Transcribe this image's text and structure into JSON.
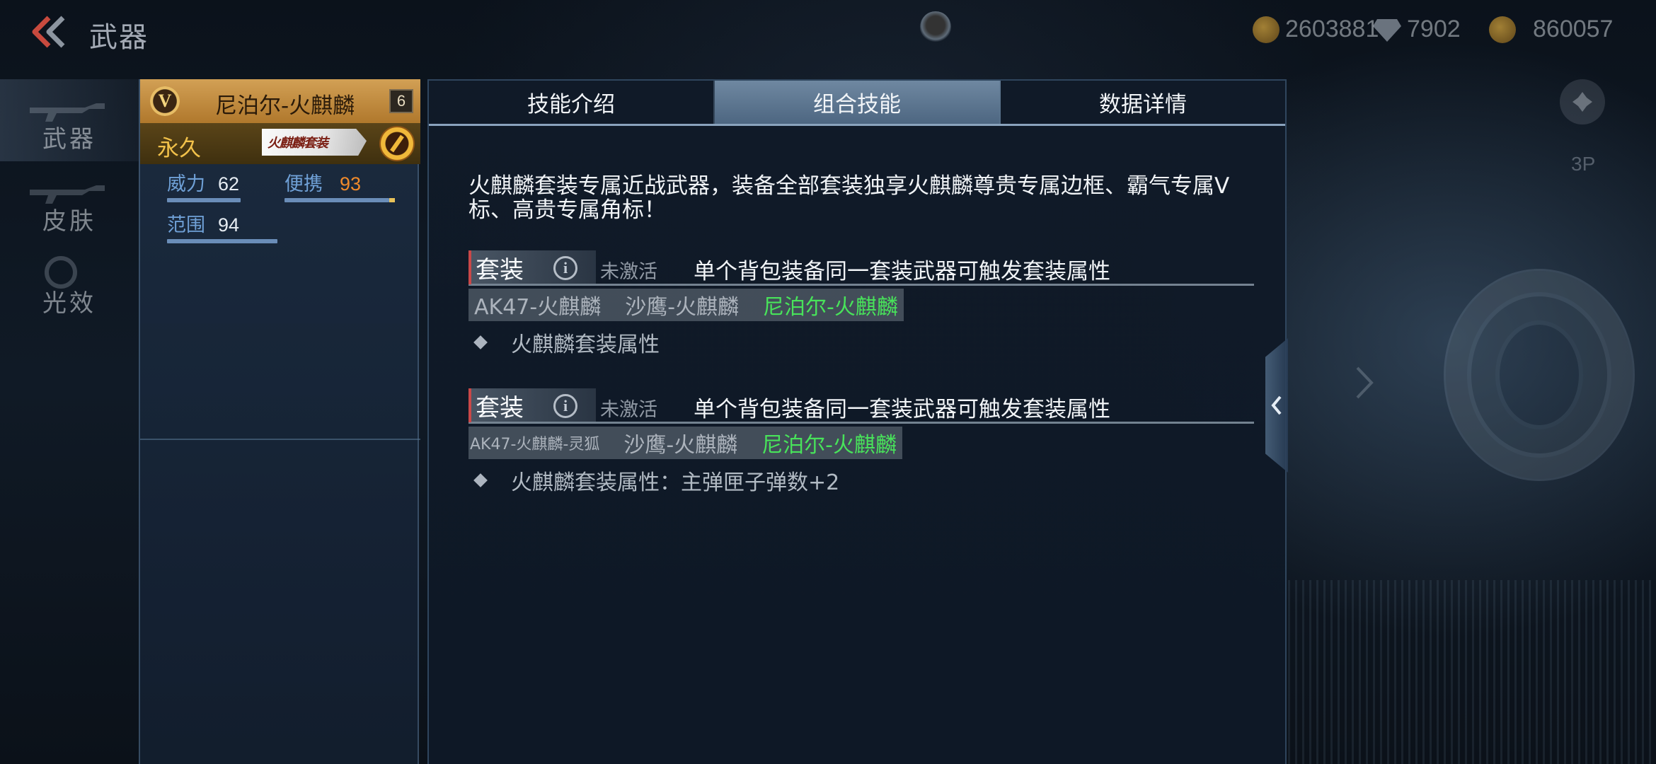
{
  "header": {
    "title": "武器",
    "currencies": [
      {
        "icon": "coin-icon",
        "value": "2603881"
      },
      {
        "icon": "diamond-icon",
        "value": "7902"
      },
      {
        "icon": "coin-icon",
        "value": "860057"
      }
    ]
  },
  "sidenav": {
    "items": [
      {
        "label": "武器",
        "active": true
      },
      {
        "label": "皮肤",
        "active": false
      },
      {
        "label": "光效",
        "active": false
      }
    ]
  },
  "weapon": {
    "badge": "V",
    "name": "尼泊尔-火麒麟",
    "level": "6",
    "duration": "永久",
    "set_tag": "火麒麟套装",
    "stats": [
      {
        "label": "威力",
        "value": "62",
        "fill": 0.62
      },
      {
        "label": "便携",
        "value": "93",
        "fill": 0.93
      },
      {
        "label": "范围",
        "value": "94",
        "fill": 0.94
      }
    ]
  },
  "tabs": [
    "技能介绍",
    "组合技能",
    "数据详情"
  ],
  "active_tab": 1,
  "description": "火麒麟套装专属近战武器，装备全部套装独享火麒麟尊贵专属边框、霸气专属V标、高贵专属角标！",
  "suits": [
    {
      "label": "套装",
      "info_icon": "i",
      "status": "未激活",
      "rule": "单个背包装备同一套装武器可触发套装属性",
      "pieces": [
        "AK47-火麒麟",
        "沙鹰-火麒麟",
        "尼泊尔-火麒麟"
      ],
      "attribute": "火麒麟套装属性"
    },
    {
      "label": "套装",
      "info_icon": "i",
      "status": "未激活",
      "rule": "单个背包装备同一套装武器可触发套装属性",
      "pieces": [
        "AK47-火麒麟-灵狐",
        "沙鹰-火麒麟",
        "尼泊尔-火麒麟"
      ],
      "attribute": "火麒麟套装属性：主弹匣子弹数+2"
    }
  ],
  "right": {
    "view_mode": "3P"
  },
  "colors": {
    "accent_gold": "#d2a055",
    "active_green": "#48e35a",
    "stat_orange": "#f08a2a",
    "stat_blue": "#6fa0d6"
  }
}
